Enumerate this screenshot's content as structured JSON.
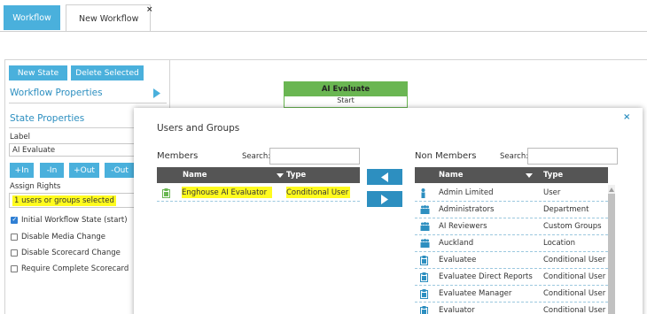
{
  "tabs": {
    "workflow": "Workflow",
    "new_workflow": "New Workflow",
    "close": "×"
  },
  "left_panel": {
    "new_state": "New State",
    "delete_selected": "Delete Selected",
    "workflow_properties": "Workflow Properties",
    "state_properties": "State Properties",
    "label_caption": "Label",
    "label_value": "AI Evaluate",
    "buttons": [
      "+In",
      "-In",
      "+Out",
      "-Out"
    ],
    "assign_rights": "Assign Rights",
    "rights_summary": "1 users or groups selected",
    "checkboxes": [
      {
        "label": "Initial Workflow State (start)",
        "checked": true
      },
      {
        "label": "Disable Media Change",
        "checked": false
      },
      {
        "label": "Disable Scorecard Change",
        "checked": false
      },
      {
        "label": "Require Complete Scorecard",
        "checked": false
      }
    ]
  },
  "state_node": {
    "title": "AI Evaluate",
    "subtitle": "Start",
    "color": "#6ab652"
  },
  "modal": {
    "title": "Users and Groups",
    "close": "×",
    "members": {
      "title": "Members",
      "search_label": "Search:",
      "search_value": "",
      "col_name": "Name",
      "col_type": "Type",
      "rows": [
        {
          "name": "Enghouse AI Evaluator",
          "type": "Conditional User",
          "icon": "clipboard-icon",
          "highlighted": true
        }
      ]
    },
    "non_members": {
      "title": "Non Members",
      "search_label": "Search:",
      "search_value": "",
      "col_name": "Name",
      "col_type": "Type",
      "rows": [
        {
          "name": "Admin Limited",
          "type": "User",
          "icon": "person-icon"
        },
        {
          "name": "Administrators",
          "type": "Department",
          "icon": "group-icon"
        },
        {
          "name": "AI Reviewers",
          "type": "Custom Groups",
          "icon": "group-icon"
        },
        {
          "name": "Auckland",
          "type": "Location",
          "icon": "group-icon"
        },
        {
          "name": "Evaluatee",
          "type": "Conditional User",
          "icon": "clipboard-icon"
        },
        {
          "name": "Evaluatee Direct Reports",
          "type": "Conditional User",
          "icon": "clipboard-icon"
        },
        {
          "name": "Evaluatee Manager",
          "type": "Conditional User",
          "icon": "clipboard-icon"
        },
        {
          "name": "Evaluator",
          "type": "Conditional User",
          "icon": "clipboard-icon"
        }
      ]
    }
  },
  "colors": {
    "accent": "#4ab0dc",
    "link": "#2d8fc0",
    "highlight": "#fffb1e",
    "grid_header": "#555555"
  }
}
